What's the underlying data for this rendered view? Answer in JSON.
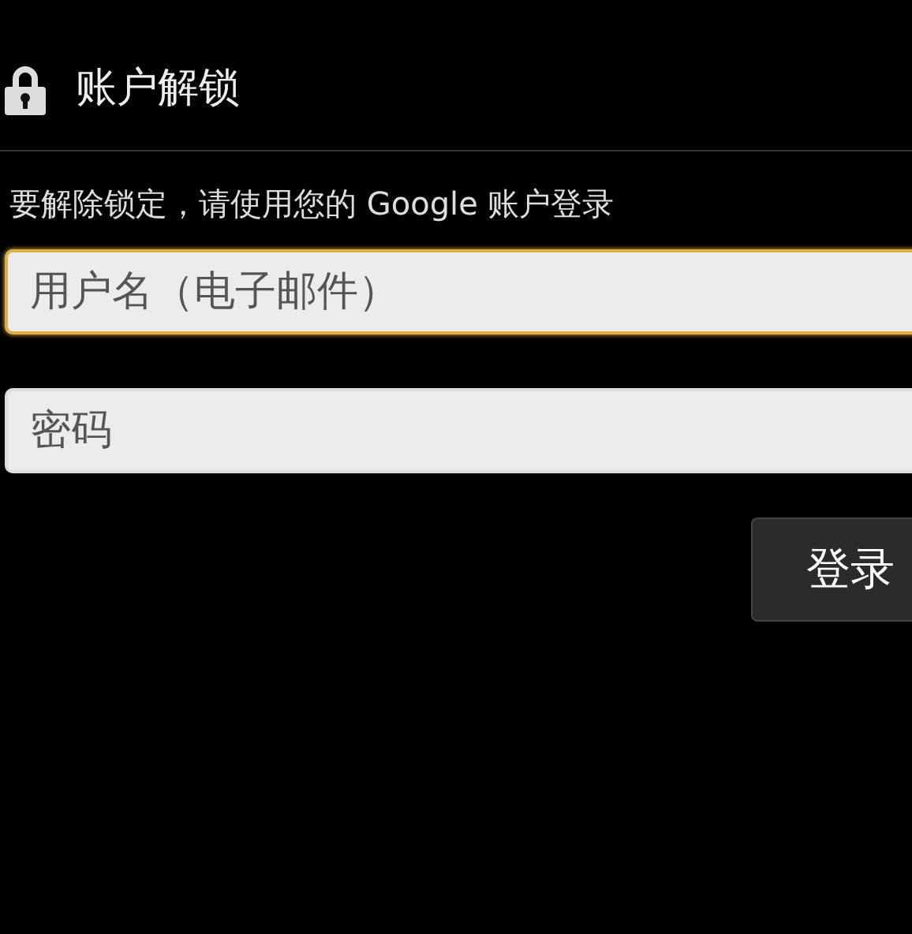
{
  "window": {
    "title": "账户解锁"
  },
  "instruction": "要解除锁定，请使用您的 Google 账户登录",
  "fields": [
    {
      "placeholder": "用户名（电子邮件）",
      "focused": true
    },
    {
      "placeholder": "密码",
      "focused": false
    }
  ],
  "buttons": [
    "登录"
  ]
}
